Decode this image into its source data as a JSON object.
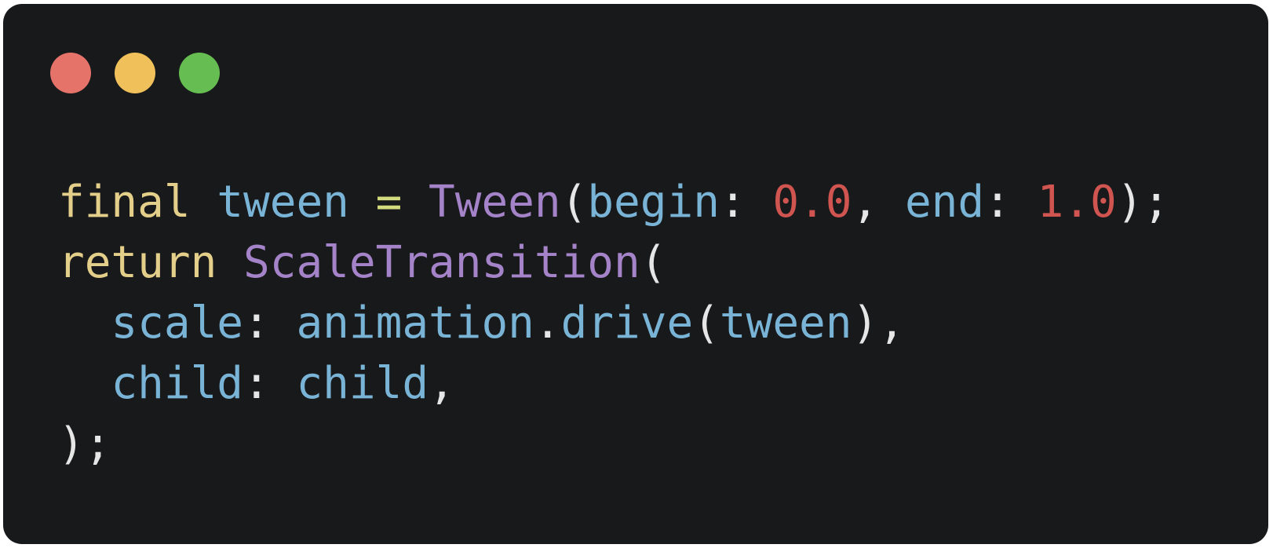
{
  "window_controls": {
    "close_color": "#e6736a",
    "minimize_color": "#f0c05b",
    "maximize_color": "#66bd51"
  },
  "colors": {
    "keyword": "#e4cf8a",
    "identifier": "#79b4d6",
    "class": "#a583c9",
    "number": "#d0544f",
    "punctuation": "#e6e6e6",
    "operator": "#d3db7f"
  },
  "code_lines": [
    [
      {
        "text": "final",
        "type": "keyword"
      },
      {
        "text": " ",
        "type": "punctuation"
      },
      {
        "text": "tween",
        "type": "identifier"
      },
      {
        "text": " ",
        "type": "punctuation"
      },
      {
        "text": "=",
        "type": "operator"
      },
      {
        "text": " ",
        "type": "punctuation"
      },
      {
        "text": "Tween",
        "type": "class"
      },
      {
        "text": "(",
        "type": "punctuation"
      },
      {
        "text": "begin",
        "type": "identifier"
      },
      {
        "text": ": ",
        "type": "punctuation"
      },
      {
        "text": "0.0",
        "type": "number"
      },
      {
        "text": ", ",
        "type": "punctuation"
      },
      {
        "text": "end",
        "type": "identifier"
      },
      {
        "text": ": ",
        "type": "punctuation"
      },
      {
        "text": "1.0",
        "type": "number"
      },
      {
        "text": ");",
        "type": "punctuation"
      }
    ],
    [
      {
        "text": "return",
        "type": "keyword"
      },
      {
        "text": " ",
        "type": "punctuation"
      },
      {
        "text": "ScaleTransition",
        "type": "class"
      },
      {
        "text": "(",
        "type": "punctuation"
      }
    ],
    [
      {
        "text": "  ",
        "type": "punctuation"
      },
      {
        "text": "scale",
        "type": "identifier"
      },
      {
        "text": ": ",
        "type": "punctuation"
      },
      {
        "text": "animation",
        "type": "identifier"
      },
      {
        "text": ".",
        "type": "punctuation"
      },
      {
        "text": "drive",
        "type": "identifier"
      },
      {
        "text": "(",
        "type": "punctuation"
      },
      {
        "text": "tween",
        "type": "identifier"
      },
      {
        "text": "),",
        "type": "punctuation"
      }
    ],
    [
      {
        "text": "  ",
        "type": "punctuation"
      },
      {
        "text": "child",
        "type": "identifier"
      },
      {
        "text": ": ",
        "type": "punctuation"
      },
      {
        "text": "child",
        "type": "identifier"
      },
      {
        "text": ",",
        "type": "punctuation"
      }
    ],
    [
      {
        "text": ");",
        "type": "punctuation"
      }
    ]
  ]
}
